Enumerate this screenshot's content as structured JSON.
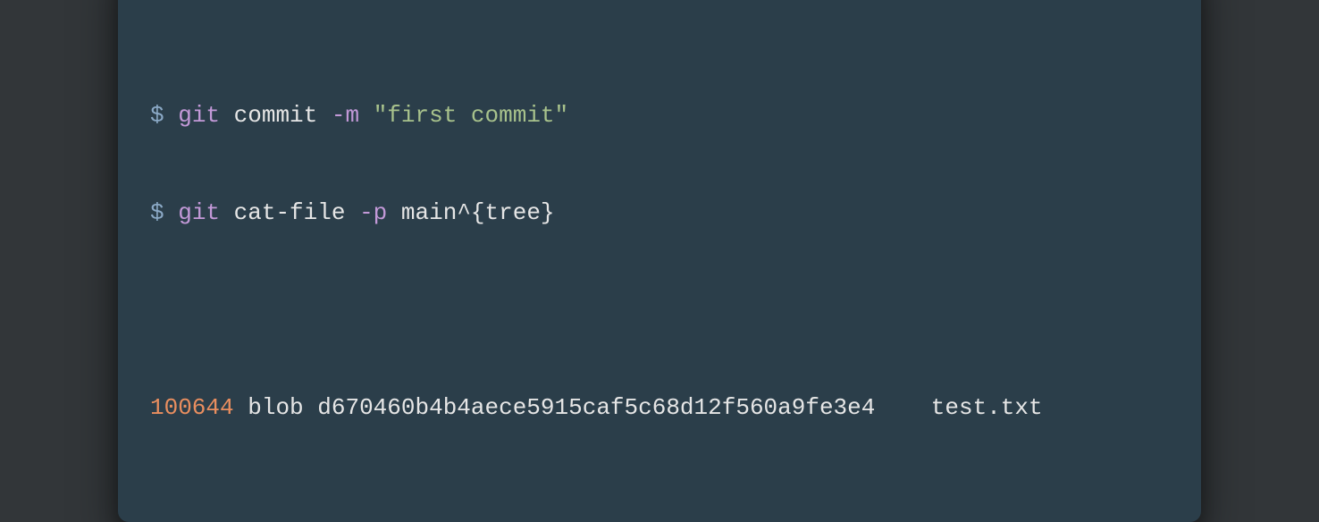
{
  "colors": {
    "background": "#323639",
    "terminal_bg": "#2b3e4a",
    "dot_red": "#ff5f56",
    "dot_yellow": "#ffbd2e",
    "dot_green": "#27c93f",
    "prompt": "#8ba9c6",
    "command": "#c399d8",
    "string": "#a8c28c",
    "mode": "#e98e5f",
    "text": "#e6e6e6"
  },
  "lines": {
    "line1": {
      "prompt": "$ ",
      "cmd": "git",
      "space1": " ",
      "subcmd": "commit",
      "space2": " ",
      "flag": "-m",
      "space3": " ",
      "string": "\"first commit\""
    },
    "line2": {
      "prompt": "$ ",
      "cmd": "git",
      "space1": " ",
      "subcmd": "cat-file",
      "space2": " ",
      "flag": "-p",
      "space3": " ",
      "arg": "main^{tree}"
    },
    "output": {
      "mode": "100644",
      "space1": " ",
      "type": "blob",
      "space2": " ",
      "hash": "d670460b4b4aece5915caf5c68d12f560a9fe3e4",
      "gap": "    ",
      "filename": "test.txt"
    }
  }
}
